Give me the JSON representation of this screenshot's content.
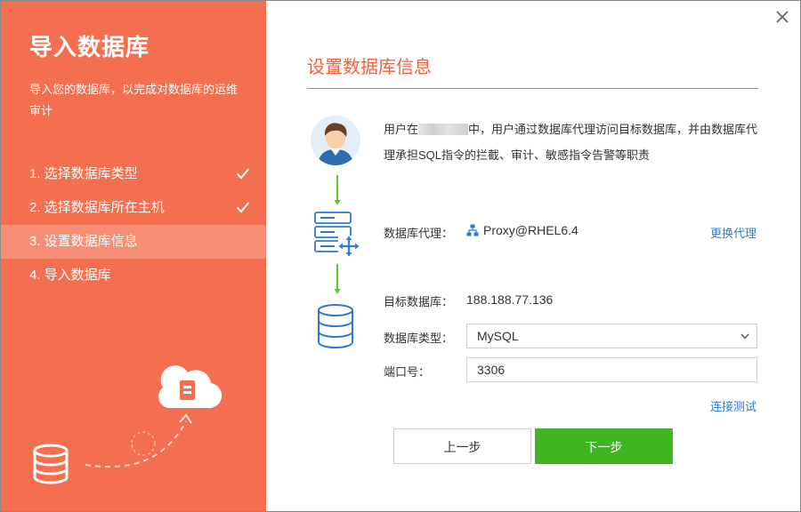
{
  "sidebar": {
    "title": "导入数据库",
    "description": "导入您的数据库，以完成对数据库的运维审计",
    "steps": [
      {
        "label": "1. 选择数据库类型",
        "done": true
      },
      {
        "label": "2. 选择数据库所在主机",
        "done": true
      },
      {
        "label": "3. 设置数据库信息",
        "active": true
      },
      {
        "label": "4. 导入数据库"
      }
    ]
  },
  "main": {
    "title": "设置数据库信息",
    "info_prefix": "用户在",
    "info_suffix": "中，用户通过数据库代理访问目标数据库，并由数据库代理承担SQL指令的拦截、审计、敏感指令告警等职责",
    "proxy_label": "数据库代理：",
    "proxy_value": "Proxy@RHEL6.4",
    "change_proxy_link": "更换代理",
    "target_label": "目标数据库：",
    "target_value": "188.188.77.136",
    "type_label": "数据库类型：",
    "type_value": "MySQL",
    "port_label": "端口号：",
    "port_value": "3306",
    "test_link": "连接测试"
  },
  "buttons": {
    "prev": "上一步",
    "next": "下一步"
  },
  "colors": {
    "accent": "#f46f50",
    "primary_button": "#3fb51f",
    "link": "#2a7cd4",
    "title_text": "#f2613f"
  }
}
